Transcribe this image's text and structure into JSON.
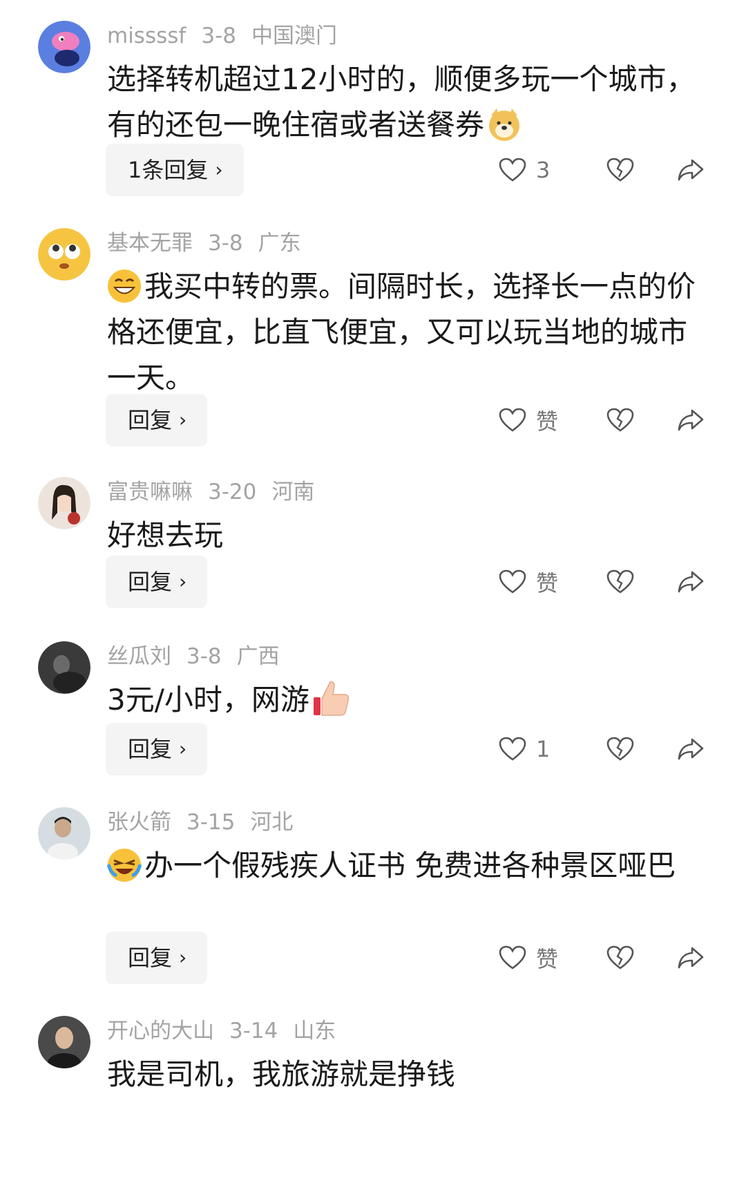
{
  "comments": [
    {
      "user": "missssf",
      "date": "3-8",
      "location": "中国澳门",
      "text": "选择转机超过12小时的，顺便多玩一个城市，有的还包一晚住宿或者送餐券",
      "trailing_emoji": "doge-emoji",
      "reply_label": "1条回复",
      "like_label": "3",
      "avatar_color": "#5a7fe0"
    },
    {
      "user": "基本无罪",
      "date": "3-8",
      "location": "广东",
      "leading_emoji": "grin-emoji",
      "text": "我买中转的票。间隔时长，选择长一点的价格还便宜，比直飞便宜，又可以玩当地的城市一天。",
      "reply_label": "回复",
      "like_label": "赞",
      "avatar_color": "#f5c542"
    },
    {
      "user": "富贵嘛嘛",
      "date": "3-20",
      "location": "河南",
      "text": "好想去玩",
      "reply_label": "回复",
      "like_label": "赞",
      "avatar_color": "#c9b6a4"
    },
    {
      "user": "丝瓜刘",
      "date": "3-8",
      "location": "广西",
      "text": "3元/小时，网游",
      "trailing_emoji": "thumbs-up-emoji",
      "reply_label": "回复",
      "like_label": "1",
      "avatar_color": "#3a3a3a"
    },
    {
      "user": "张火箭",
      "date": "3-15",
      "location": "河北",
      "leading_emoji": "laughing-crying-emoji",
      "text": "办一个假残疾人证书 免费进各种景区哑巴",
      "reply_label": "回复",
      "like_label": "赞",
      "avatar_color": "#b9c2c8"
    },
    {
      "user": "开心的大山",
      "date": "3-14",
      "location": "山东",
      "text": "我是司机，我旅游就是挣钱",
      "avatar_color": "#4a4a4a"
    }
  ]
}
